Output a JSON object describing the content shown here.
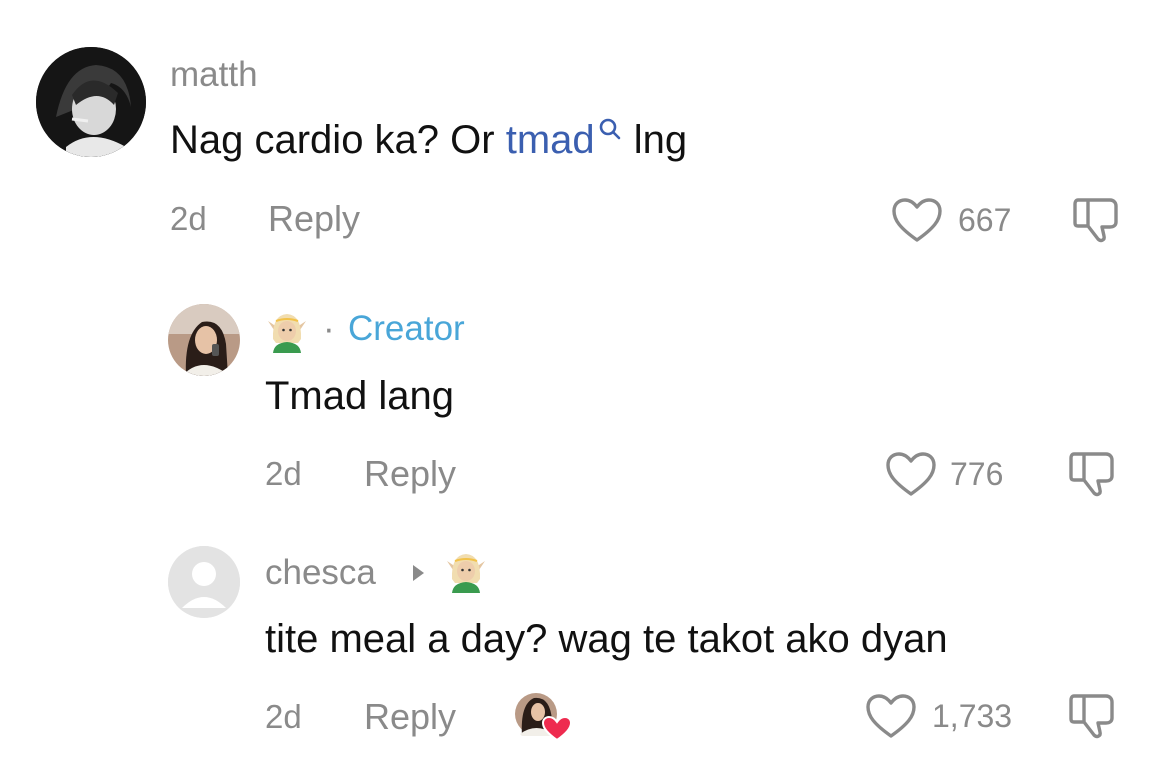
{
  "colors": {
    "link": "#3b5fb0",
    "creator": "#49a6d8",
    "muted": "#8a8a8a",
    "text": "#111111",
    "heart_badge": "#ee2b4f"
  },
  "comments": [
    {
      "username": "matth",
      "text_before": "Nag cardio ka? Or ",
      "link_text": "tmad",
      "link_icon": "search-icon",
      "text_after": " lng",
      "time": "2d",
      "reply_label": "Reply",
      "likes": "667",
      "like_icon": "heart-outline-icon",
      "dislike_icon": "thumbs-down-icon"
    },
    {
      "username_emoji": "elf-emoji",
      "separator": "·",
      "badge": "Creator",
      "text": "Tmad lang",
      "time": "2d",
      "reply_label": "Reply",
      "likes": "776",
      "like_icon": "heart-outline-icon",
      "dislike_icon": "thumbs-down-icon"
    },
    {
      "username": "chesca",
      "reply_to_icon": "caret-right-icon",
      "reply_to_emoji": "elf-emoji",
      "text": "tite meal a day? wag te takot ako dyan",
      "time": "2d",
      "reply_label": "Reply",
      "creator_liked_icon": "creator-liked-heart-icon",
      "likes": "1,733",
      "like_icon": "heart-outline-icon",
      "dislike_icon": "thumbs-down-icon"
    }
  ]
}
